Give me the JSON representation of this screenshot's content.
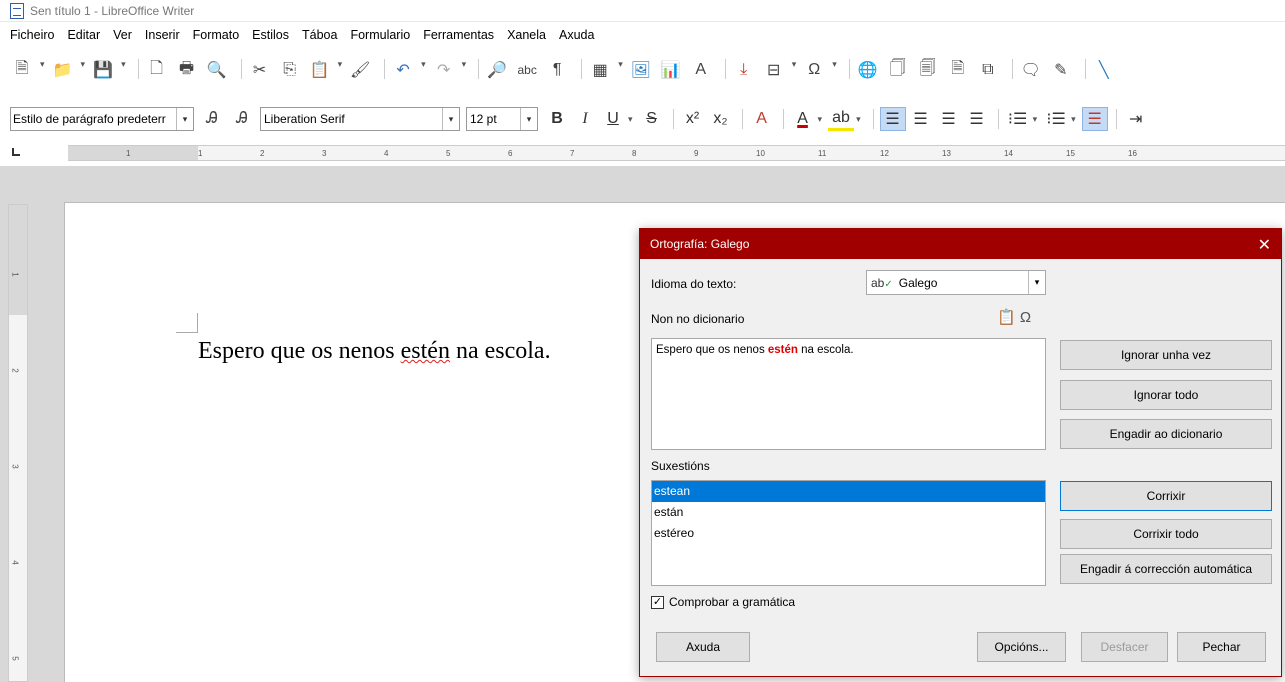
{
  "window": {
    "title": "Sen título 1 - LibreOffice Writer"
  },
  "menubar": [
    {
      "id": "ficheiro",
      "label": "Ficheiro"
    },
    {
      "id": "editar",
      "label": "Editar"
    },
    {
      "id": "ver",
      "label": "Ver"
    },
    {
      "id": "inserir",
      "label": "Inserir"
    },
    {
      "id": "formato",
      "label": "Formato"
    },
    {
      "id": "estilos",
      "label": "Estilos"
    },
    {
      "id": "taboa",
      "label": "Táboa"
    },
    {
      "id": "formulario",
      "label": "Formulario"
    },
    {
      "id": "ferramentas",
      "label": "Ferramentas"
    },
    {
      "id": "xanela",
      "label": "Xanela"
    },
    {
      "id": "axuda",
      "label": "Axuda"
    }
  ],
  "formatting": {
    "paragraph_style": "Estilo de parágrafo predeterr",
    "font_name": "Liberation Serif",
    "font_size": "12 pt"
  },
  "ruler": {
    "ticks": [
      "1",
      "1",
      "2",
      "3",
      "4",
      "5",
      "6",
      "7",
      "8",
      "9",
      "10",
      "11",
      "12",
      "13",
      "14",
      "15",
      "16"
    ]
  },
  "vruler": {
    "ticks": [
      "1",
      "2",
      "3",
      "4",
      "5"
    ]
  },
  "document": {
    "text_before": "Espero que os nenos ",
    "text_error": "estén",
    "text_after": " na escola."
  },
  "dialog": {
    "title": "Ortografía: Galego",
    "language_label": "Idioma do texto:",
    "language_value": "Galego",
    "not_in_dict_label": "Non no dicionario",
    "sentence_before": "Espero que os nenos ",
    "sentence_error": "estén",
    "sentence_after": " na escola.",
    "suggestions_label": "Suxestións",
    "suggestions": [
      "estean",
      "están",
      "estéreo"
    ],
    "check_grammar_label": "Comprobar a gramática",
    "buttons": {
      "ignore_once": "Ignorar unha vez",
      "ignore_all": "Ignorar todo",
      "add_dict": "Engadir ao dicionario",
      "correct": "Corrixir",
      "correct_all": "Corrixir todo",
      "autocorrect": "Engadir á corrección automática",
      "help": "Axuda",
      "options": "Opcións...",
      "undo": "Desfacer",
      "close": "Pechar"
    }
  },
  "colors": {
    "dialog_accent": "#a00000",
    "selection": "#0078d7",
    "error": "#e00000"
  }
}
